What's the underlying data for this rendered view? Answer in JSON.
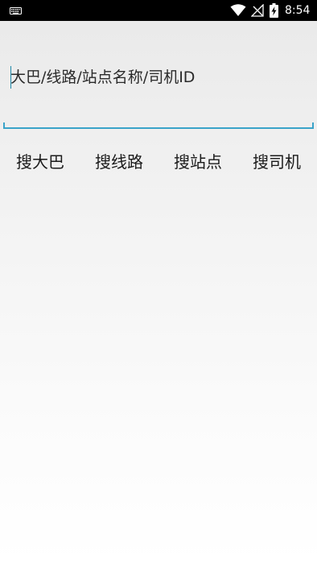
{
  "status_bar": {
    "time": "8:54",
    "icons": [
      "keyboard-icon",
      "wifi-icon",
      "signal-off-icon",
      "battery-charging-icon"
    ]
  },
  "search": {
    "placeholder": "大巴/线路/站点名称/司机ID",
    "value": "",
    "accent_color": "#3aa3c9"
  },
  "search_types": {
    "bus": "搜大巴",
    "route": "搜线路",
    "station": "搜站点",
    "driver": "搜司机"
  }
}
